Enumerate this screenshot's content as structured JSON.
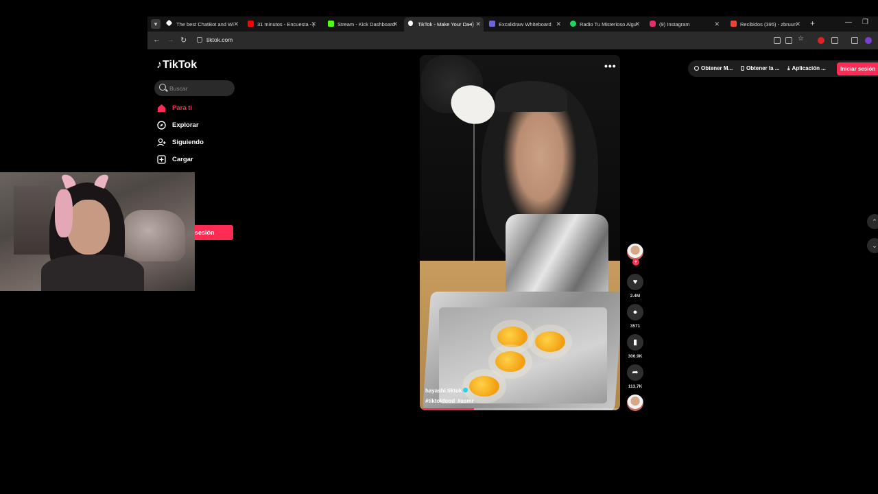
{
  "browser": {
    "tabs": [
      {
        "title": "The best ChatBot and Wi",
        "favicon_color": "#ffffff"
      },
      {
        "title": "31 minutos - Encuesta - j",
        "favicon_color": "#ff0000"
      },
      {
        "title": "Stream - Kick Dashboard",
        "favicon_color": "#53fc18"
      },
      {
        "title": "TikTok - Make Your Da",
        "favicon_color": "#ffffff"
      },
      {
        "title": "Excalidraw Whiteboard",
        "favicon_color": "#6965db"
      },
      {
        "title": "Radio Tu Misterioso Algu",
        "favicon_color": "#1ed760"
      },
      {
        "title": "(9) Instagram",
        "favicon_color": "#e1306c"
      },
      {
        "title": "Recibidos (395) - zbruun",
        "favicon_color": "#ea4335"
      }
    ],
    "new_tab": "+",
    "url": "tiktok.com"
  },
  "tiktok": {
    "logo_text": "TikTok",
    "search_placeholder": "Buscar",
    "nav": [
      {
        "label": "Para ti"
      },
      {
        "label": "Explorar"
      },
      {
        "label": "Siguiendo"
      },
      {
        "label": "Cargar"
      }
    ],
    "sidebar_login_label": "sesión",
    "header": {
      "get_coins": "Obtener M...",
      "get_app": "Obtener la ...",
      "app": "Aplicación ...",
      "login": "Iniciar sesión"
    },
    "video": {
      "username": "hayashi.tiktok",
      "tags": [
        "#tiktokfood",
        "#asmr"
      ],
      "progress": 0.27,
      "more": "•••"
    },
    "actions": {
      "likes": "2.4M",
      "comments": "3571",
      "saves": "306.9K",
      "shares": "113.7K"
    }
  },
  "colors": {
    "accent": "#fe2c55",
    "background": "#000000"
  }
}
